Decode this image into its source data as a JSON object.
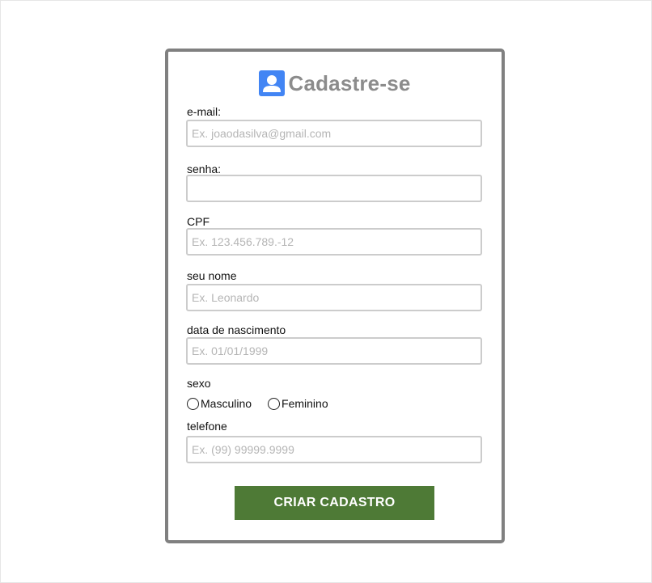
{
  "form": {
    "title": "Cadastre-se",
    "icon": "user-icon",
    "accent_color": "#4285f4",
    "fields": {
      "email": {
        "label": "e-mail:",
        "placeholder": "Ex. joaodasilva@gmail.com",
        "value": ""
      },
      "senha": {
        "label": "senha:",
        "placeholder": "",
        "value": ""
      },
      "cpf": {
        "label": "CPF",
        "placeholder": "Ex. 123.456.789.-12",
        "value": ""
      },
      "nome": {
        "label": "seu nome",
        "placeholder": "Ex. Leonardo",
        "value": ""
      },
      "nascimento": {
        "label": "data de nascimento",
        "placeholder": "Ex. 01/01/1999",
        "value": ""
      },
      "telefone": {
        "label": "telefone",
        "placeholder": "Ex. (99) 99999.9999",
        "value": ""
      }
    },
    "sexo": {
      "label": "sexo",
      "options": [
        "Masculino",
        "Feminino"
      ],
      "selected": null
    },
    "submit_label": "CRIAR CADASTRO",
    "submit_color": "#4e7a36"
  }
}
